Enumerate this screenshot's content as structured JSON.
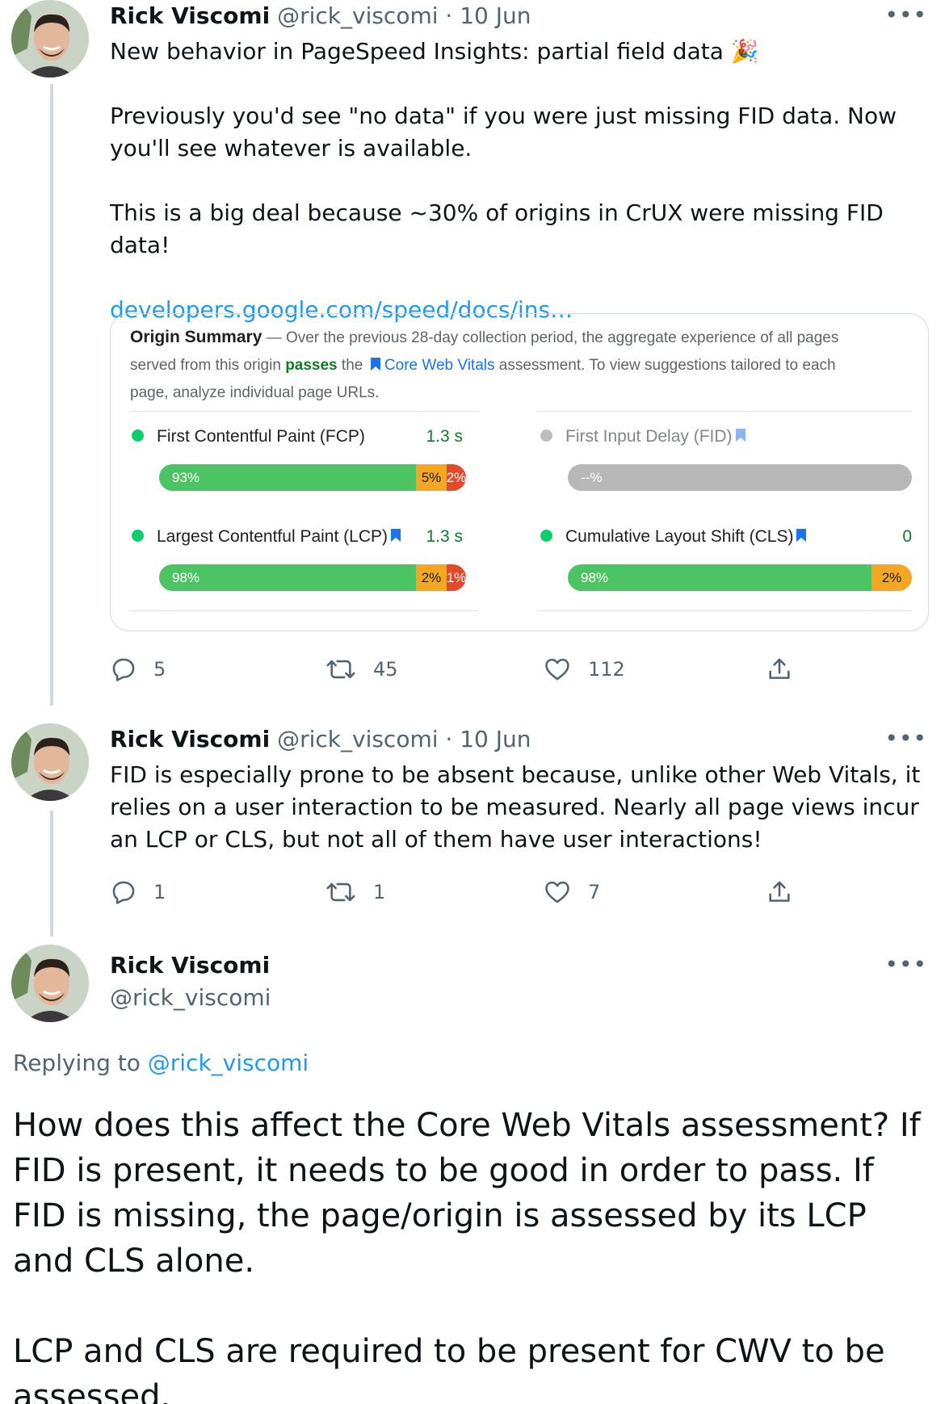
{
  "tweets": [
    {
      "name": "Rick Viscomi",
      "handle": "@rick_viscomi",
      "date": "· 10 Jun",
      "more": "•••",
      "text": [
        "New behavior in PageSpeed Insights: partial field data 🎉",
        "Previously you'd see \"no data\" if you were just missing FID data. Now you'll see whatever is available.",
        "This is a big deal because ~30% of origins in CrUX were missing FID data!"
      ],
      "link": "developers.google.com/speed/docs/ins…",
      "replies": "5",
      "retweets": "45",
      "likes": "112"
    },
    {
      "name": "Rick Viscomi",
      "handle": "@rick_viscomi",
      "date": "· 10 Jun",
      "more": "•••",
      "text": "FID is especially prone to be absent because, unlike other Web Vitals, it relies on a user interaction to be measured. Nearly all page views incur an LCP or CLS, but not all of them have user interactions!",
      "replies": "1",
      "retweets": "1",
      "likes": "7"
    },
    {
      "name": "Rick Viscomi",
      "handle": "@rick_viscomi",
      "more": "•••",
      "replying_label": "Replying to",
      "replying_handle": "@rick_viscomi",
      "text": [
        "How does this affect the Core Web Vitals assessment? If FID is present, it needs to be good in order to pass. If FID is missing, the page/origin is assessed by its LCP and CLS alone.",
        "LCP and CLS are required to be present for CWV to be assessed."
      ]
    }
  ],
  "card": {
    "title": "Origin Summary",
    "summary_a": " — Over the previous 28-day collection period, the aggregate experience of all pages served from this origin ",
    "passes": "passes",
    "summary_b": " the ",
    "cwv": "Core Web Vitals",
    "summary_c": " assessment. To view suggestions tailored to each page, analyze individual page URLs.",
    "metrics": [
      {
        "label": "First Contentful Paint (FCP)",
        "value": "1.3 s",
        "good": 93,
        "ni": 5,
        "poor": 2,
        "good_label": "93%",
        "ni_label": "5%",
        "poor_label": "2%"
      },
      {
        "label": "First Input Delay (FID)",
        "value": "",
        "empty_label": "--%"
      },
      {
        "label": "Largest Contentful Paint (LCP)",
        "value": "1.3 s",
        "good": 98,
        "ni": 2,
        "poor": 1,
        "good_label": "98%",
        "ni_label": "2%",
        "poor_label": "1%"
      },
      {
        "label": "Cumulative Layout Shift (CLS)",
        "value": "0",
        "good": 98,
        "ni": 2,
        "good_label": "98%",
        "ni_label": "2%"
      }
    ]
  },
  "colors": {
    "good": "#4cc463",
    "ni": "#f5a623",
    "poor": "#e5492b",
    "link": "#1d9bf0",
    "pass": "#0d7e22",
    "cwv": "#1a73e8"
  }
}
